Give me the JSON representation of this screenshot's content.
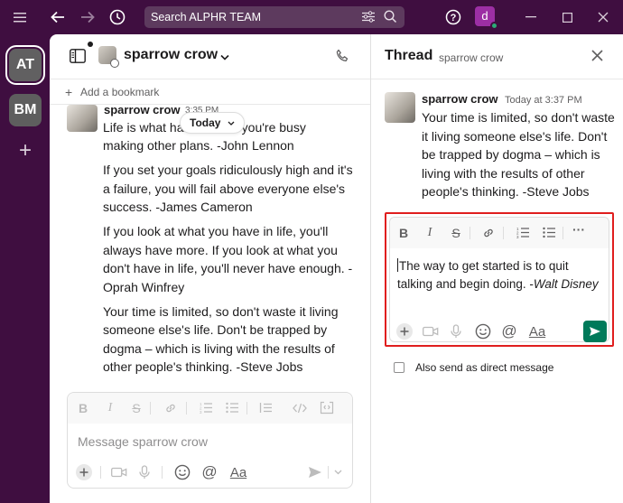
{
  "titlebar": {
    "search_placeholder": "Search ALPHR TEAM",
    "user_initial": "d"
  },
  "workspaces": [
    {
      "label": "AT"
    },
    {
      "label": "BM"
    }
  ],
  "add_workspace": "+",
  "channel": {
    "name": "sparrow crow",
    "add_bookmark": "Add a bookmark",
    "today_label": "Today",
    "message": {
      "author": "sparrow crow",
      "time": "3:35 PM",
      "lines": [
        "Life is what ha",
        "n you're busy",
        "making other plans. -John Lennon",
        "If you set your goals ridiculously high and it's",
        "a failure, you will fail above everyone else's",
        "success. -James Cameron",
        "If you look at what you have in life, you'll",
        "always have more. If you look at what you",
        "don't have in life, you'll never have enough. -",
        "Oprah Winfrey",
        "Your time is limited, so don't waste it living",
        "someone else's life. Don't be trapped by",
        "dogma – which is living with the results of",
        "other people's thinking. -Steve Jobs"
      ]
    },
    "composer_placeholder": "Message sparrow crow",
    "text_style_label": "Aa"
  },
  "thread": {
    "title": "Thread",
    "subtitle": "sparrow crow",
    "author": "sparrow crow",
    "time": "Today at 3:37 PM",
    "lines": [
      "Your time is limited, so don't waste",
      "it living someone else's life. Don't",
      "be trapped by dogma – which is",
      "living with the results of other",
      "people's thinking. -Steve Jobs"
    ],
    "reply_text_line1": "The way to get started is to quit",
    "reply_text_line2a": "talking and begin doing. -",
    "reply_text_line2b": "Walt Disney",
    "text_style_label": "Aa",
    "also_send_label": "Also send as direct message"
  },
  "colors": {
    "aubergine": "#3f0e40",
    "send_green": "#007a5a",
    "highlight_red": "#e01e1e",
    "presence_green": "#2bac76"
  }
}
